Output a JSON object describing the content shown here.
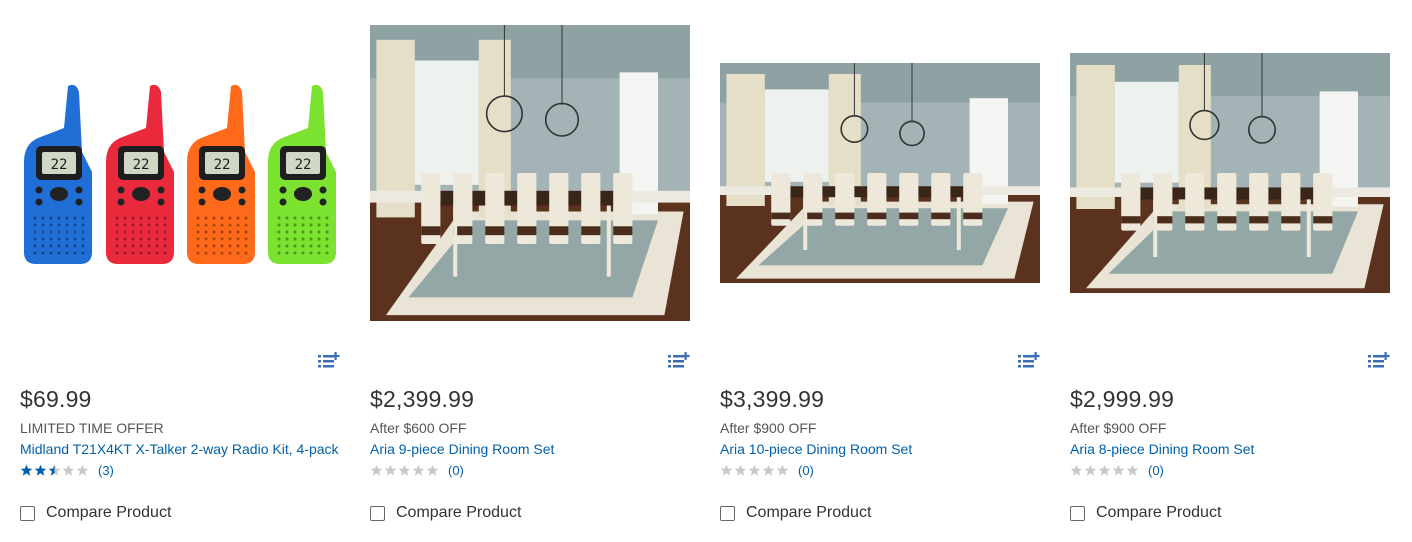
{
  "products": [
    {
      "image": "walkie-talkie-4pack",
      "price": "$69.99",
      "promo": "LIMITED TIME OFFER",
      "title": "Midland T21X4KT X-Talker 2-way Radio Kit, 4-pack",
      "rating": 2.5,
      "review_count": "(3)",
      "compare_label": "Compare Product"
    },
    {
      "image": "dining-room-9-piece",
      "price": "$2,399.99",
      "promo": "After $600 OFF",
      "title": "Aria 9-piece Dining Room Set",
      "rating": 0,
      "review_count": "(0)",
      "compare_label": "Compare Product"
    },
    {
      "image": "dining-room-10-piece",
      "price": "$3,399.99",
      "promo": "After $900 OFF",
      "title": "Aria 10-piece Dining Room Set",
      "rating": 0,
      "review_count": "(0)",
      "compare_label": "Compare Product"
    },
    {
      "image": "dining-room-8-piece",
      "price": "$2,999.99",
      "promo": "After $900 OFF",
      "title": "Aria 8-piece Dining Room Set",
      "rating": 0,
      "review_count": "(0)",
      "compare_label": "Compare Product"
    }
  ],
  "icons": {
    "add_to_list": "add-to-list-icon",
    "star": "star-icon"
  },
  "colors": {
    "link": "#0060a9",
    "star_filled": "#0060a9",
    "star_empty": "#c8c8c8",
    "radio_blue": "#1f6fd6",
    "radio_red": "#ea2a3c",
    "radio_orange": "#ff6a1a",
    "radio_green": "#7be22f"
  }
}
